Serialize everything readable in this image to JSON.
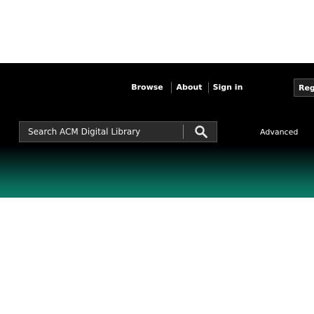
{
  "nav": {
    "items": [
      {
        "label": "Browse"
      },
      {
        "label": "About"
      },
      {
        "label": "Sign in"
      }
    ],
    "register_label": "Regi"
  },
  "search": {
    "placeholder": "Search ACM Digital Library",
    "button_icon": "search-icon"
  },
  "advanced_label": "Advanced",
  "colors": {
    "header_background": "#000000",
    "gradient_green": "#0b7b67",
    "search_box_background": "#2b2b2b"
  }
}
